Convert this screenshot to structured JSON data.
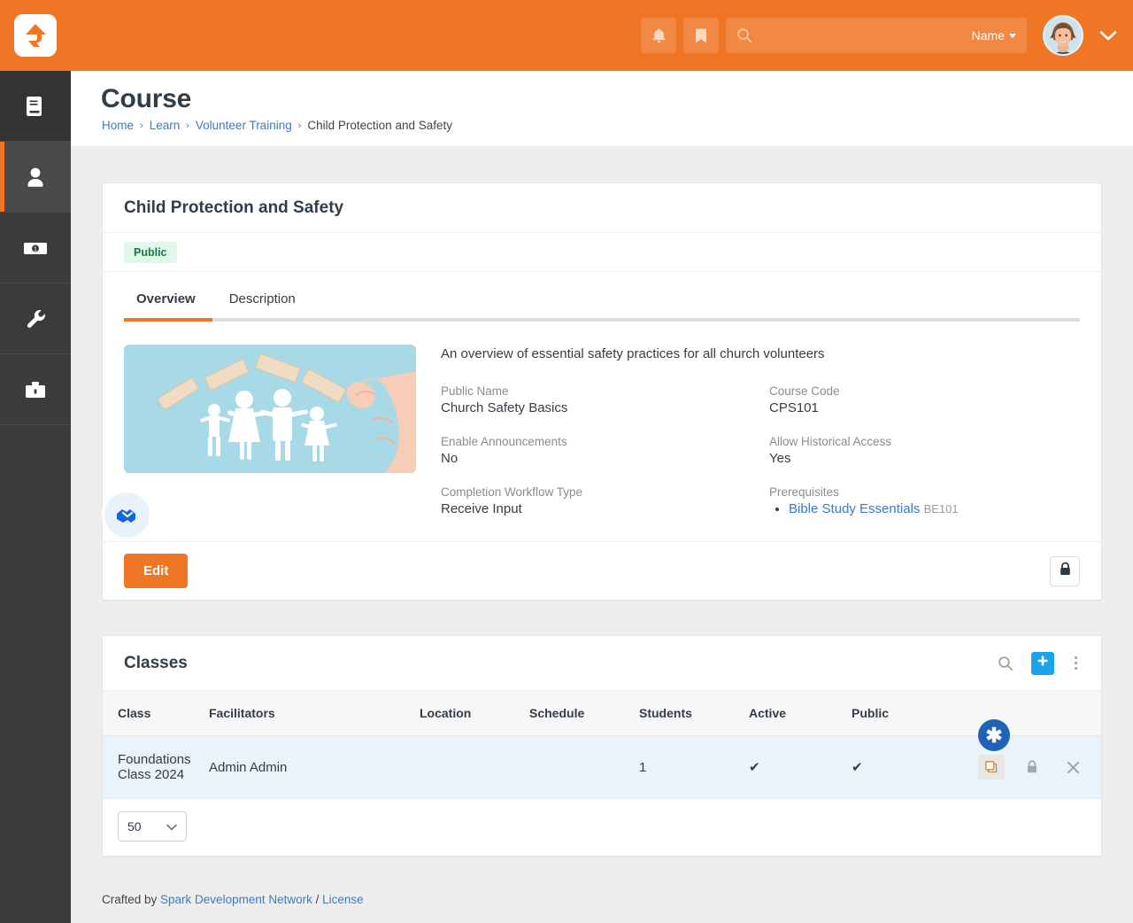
{
  "header": {
    "logo_icon": "rock-logo-icon",
    "notification_icon": "bell-icon",
    "bookmark_icon": "bookmark-icon",
    "search": {
      "icon": "search-icon",
      "value": "",
      "placeholder": "",
      "scope_label": "Name"
    },
    "avatar_icon": "user-avatar",
    "user_menu_icon": "chevron-down-icon",
    "background_color": "#ee7625"
  },
  "sidebar": {
    "items": [
      {
        "icon": "book-icon",
        "name": "sidebar-item-cms"
      },
      {
        "icon": "person-icon",
        "name": "sidebar-item-people"
      },
      {
        "icon": "money-bill-icon",
        "name": "sidebar-item-finance"
      },
      {
        "icon": "wrench-icon",
        "name": "sidebar-item-admin"
      },
      {
        "icon": "briefcase-icon",
        "name": "sidebar-item-tools"
      }
    ],
    "active_index": 1
  },
  "page": {
    "title": "Course",
    "breadcrumb": [
      {
        "label": "Home",
        "link": true
      },
      {
        "label": "Learn",
        "link": true
      },
      {
        "label": "Volunteer Training",
        "link": true
      },
      {
        "label": "Child Protection and Safety",
        "link": false
      }
    ],
    "separator": "›"
  },
  "course_panel": {
    "title": "Child Protection and Safety",
    "badge": "Public",
    "badge_bg": "#e1f7ea",
    "badge_color": "#18794a",
    "tabs": [
      {
        "label": "Overview",
        "active": true
      },
      {
        "label": "Description",
        "active": false
      }
    ],
    "thumbnail_alt": "paper family cutouts sheltered by wooden blocks",
    "thumbnail_badge_icon": "handshake-icon",
    "summary": "An overview of essential safety practices for all church volunteers",
    "fields": [
      {
        "label": "Public Name",
        "value": "Church Safety Basics"
      },
      {
        "label": "Course Code",
        "value": "CPS101"
      },
      {
        "label": "Enable Announcements",
        "value": "No"
      },
      {
        "label": "Allow Historical Access",
        "value": "Yes"
      },
      {
        "label": "Completion Workflow Type",
        "value": "Receive Input"
      }
    ],
    "prerequisites": {
      "label": "Prerequisites",
      "items": [
        {
          "name": "Bible Study Essentials",
          "code": "BE101"
        }
      ]
    },
    "edit_label": "Edit",
    "edit_color": "#ee7625",
    "security_icon": "lock-icon"
  },
  "classes_panel": {
    "title": "Classes",
    "search_icon": "search-icon",
    "add_icon": "plus-icon",
    "add_color": "#1aa3e8",
    "menu_icon": "kebab-menu-icon",
    "columns": [
      "Class",
      "Facilitators",
      "Location",
      "Schedule",
      "Students",
      "Active",
      "Public"
    ],
    "rows": [
      {
        "class": "Foundations Class 2024",
        "facilitators": "Admin Admin",
        "location": "",
        "schedule": "",
        "students": "1",
        "active": "✔",
        "public": "✔",
        "actions": [
          "copy-icon",
          "lock-icon",
          "close-icon"
        ]
      }
    ],
    "page_size": "50",
    "page_size_caret": "chevron-down-icon",
    "cursor_marker": "✱"
  },
  "footer": {
    "prefix": "Crafted by ",
    "org": "Spark Development Network",
    "divider": " / ",
    "license": "License"
  }
}
